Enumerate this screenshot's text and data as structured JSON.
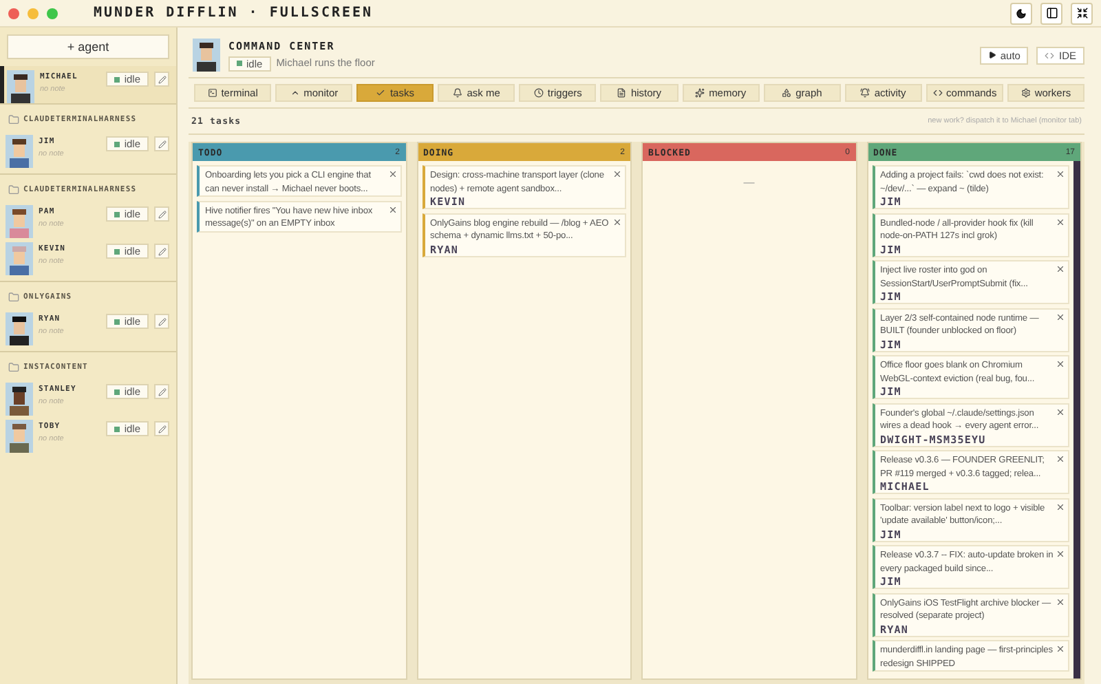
{
  "window": {
    "title": "MUNDER DIFFLIN · FULLSCREEN"
  },
  "sidebar": {
    "add_button": "+ agent",
    "top_agents": [
      {
        "name": "MICHAEL",
        "status": "idle",
        "note": "no note",
        "selected": true
      }
    ],
    "groups": [
      {
        "name": "CLAUDETERMINALHARNESS",
        "agents": [
          {
            "name": "JIM",
            "status": "idle",
            "note": "no note",
            "selected": false
          }
        ]
      },
      {
        "name": "CLAUDETERMINALHARNESS",
        "agents": [
          {
            "name": "PAM",
            "status": "idle",
            "note": "no note",
            "selected": false
          },
          {
            "name": "KEVIN",
            "status": "idle",
            "note": "no note",
            "selected": false
          }
        ]
      },
      {
        "name": "ONLYGAINS",
        "agents": [
          {
            "name": "RYAN",
            "status": "idle",
            "note": "no note",
            "selected": false
          }
        ]
      },
      {
        "name": "INSTACONTENT",
        "agents": [
          {
            "name": "STANLEY",
            "status": "idle",
            "note": "no note",
            "selected": false
          },
          {
            "name": "TOBY",
            "status": "idle",
            "note": "no note",
            "selected": false
          }
        ]
      }
    ]
  },
  "header": {
    "title": "COMMAND CENTER",
    "status": "idle",
    "subtitle": "Michael runs the floor",
    "buttons": [
      "auto",
      "IDE"
    ]
  },
  "tabs": [
    {
      "label": "terminal",
      "selected": false
    },
    {
      "label": "monitor",
      "selected": false
    },
    {
      "label": "tasks",
      "selected": true
    },
    {
      "label": "ask me",
      "selected": false
    },
    {
      "label": "triggers",
      "selected": false
    },
    {
      "label": "history",
      "selected": false
    },
    {
      "label": "memory",
      "selected": false
    },
    {
      "label": "graph",
      "selected": false
    },
    {
      "label": "activity",
      "selected": false
    },
    {
      "label": "commands",
      "selected": false
    },
    {
      "label": "workers",
      "selected": false
    }
  ],
  "toolbar": {
    "count": "21 tasks",
    "hint": "new work? dispatch it to Michael (monitor tab)"
  },
  "columns": [
    {
      "title": "TODO",
      "count": "2",
      "color": "#4a9aae",
      "cards": [
        {
          "text": "Onboarding lets you pick a CLI engine that can never install → Michael never boots..."
        },
        {
          "text": "Hive notifier fires \"You have new hive inbox message(s)\" on an EMPTY inbox"
        }
      ]
    },
    {
      "title": "DOING",
      "count": "2",
      "color": "#d9a93a",
      "cards": [
        {
          "text": "Design: cross-machine transport layer (clone nodes) + remote agent sandbox...",
          "assignee": "KEVIN"
        },
        {
          "text": "OnlyGains blog engine rebuild — /blog + AEO schema + dynamic llms.txt + 50-po...",
          "assignee": "RYAN"
        }
      ]
    },
    {
      "title": "BLOCKED",
      "count": "0",
      "color": "#d9675e",
      "empty": "—"
    },
    {
      "title": "DONE",
      "count": "17",
      "color": "#5fa77a",
      "cards": [
        {
          "text": "Adding a project fails: `cwd does not exist: ~/dev/...` — expand ~ (tilde)",
          "assignee": "JIM"
        },
        {
          "text": "Bundled-node / all-provider hook fix (kill node-on-PATH 127s incl grok)",
          "assignee": "JIM"
        },
        {
          "text": "Inject live roster into god on SessionStart/UserPromptSubmit (fix...",
          "assignee": "JIM"
        },
        {
          "text": "Layer 2/3 self-contained node runtime — BUILT (founder unblocked on floor)",
          "assignee": "JIM"
        },
        {
          "text": "Office floor goes blank on Chromium WebGL-context eviction (real bug, fou...",
          "assignee": "JIM"
        },
        {
          "text": "Founder's global ~/.claude/settings.json wires a dead hook → every agent error...",
          "assignee": "DWIGHT-MSM35EYU"
        },
        {
          "text": "Release v0.3.6 — FOUNDER GREENLIT; PR #119 merged + v0.3.6 tagged; relea...",
          "assignee": "MICHAEL"
        },
        {
          "text": "Toolbar: version label next to logo + visible 'update available' button/icon;...",
          "assignee": "JIM"
        },
        {
          "text": "Release v0.3.7 -- FIX: auto-update broken in every packaged build since...",
          "assignee": "JIM"
        },
        {
          "text": "OnlyGains iOS TestFlight archive blocker — resolved (separate project)",
          "assignee": "RYAN"
        },
        {
          "text": "munderdiffl.in landing page — first-principles redesign SHIPPED"
        }
      ]
    }
  ]
}
